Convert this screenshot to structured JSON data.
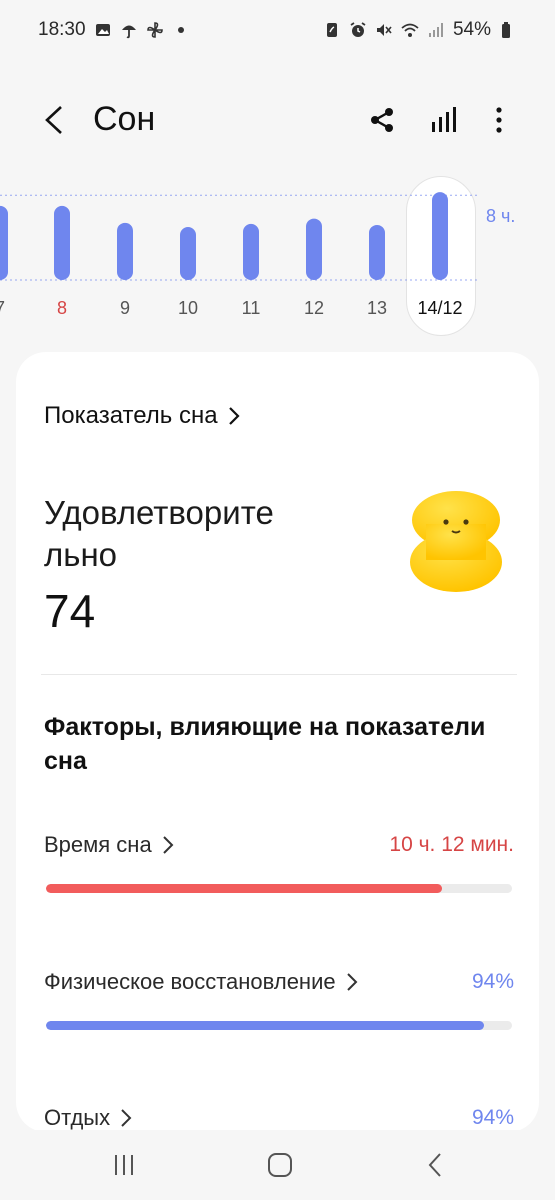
{
  "status_bar": {
    "time": "18:30",
    "battery": "54%",
    "icons_left": [
      "image-icon",
      "umbrella-icon",
      "pinwheel-icon",
      "dot-icon"
    ],
    "icons_right": [
      "nfc-icon",
      "alarm-icon",
      "mute-icon",
      "wifi-icon",
      "signal-icon",
      "battery-icon"
    ]
  },
  "header": {
    "title": "Сон",
    "back_icon": "back-chevron-icon",
    "actions": [
      "share-icon",
      "bar-chart-icon",
      "more-vertical-icon"
    ]
  },
  "chart": {
    "goal_label": "8 ч.",
    "accent_color": "#6f86ee",
    "labels": [
      "7",
      "8",
      "9",
      "10",
      "11",
      "12",
      "13",
      "14/12"
    ],
    "highlight_label": "8",
    "highlight_color": "#d64545",
    "selected_label": "14/12"
  },
  "chart_data": {
    "type": "bar",
    "categories": [
      "7",
      "8",
      "9",
      "10",
      "11",
      "12",
      "13",
      "14/12"
    ],
    "values": [
      7.0,
      7.0,
      5.4,
      5.0,
      5.3,
      5.8,
      5.2,
      8.3
    ],
    "goal": 8,
    "title": "",
    "xlabel": "",
    "ylabel": ""
  },
  "score": {
    "link_label": "Показатель сна",
    "status": "Удовлетворите льно",
    "value": "74"
  },
  "factors": {
    "title": "Факторы, влияющие на показатели сна",
    "items": [
      {
        "name": "Время сна",
        "value": "10 ч. 12 мин.",
        "progress": 0.85,
        "color": "#f25c5c",
        "value_style": "red"
      },
      {
        "name": "Физическое восстановление",
        "value": "94%",
        "progress": 0.94,
        "color": "#6f86ee",
        "value_style": "blue"
      },
      {
        "name": "Отдых",
        "value": "94%",
        "progress": 0.94,
        "color": "#6f86ee",
        "value_style": "blue"
      }
    ]
  },
  "nav_bar": {
    "buttons": [
      "recent-apps-icon",
      "home-icon",
      "back-icon"
    ]
  }
}
